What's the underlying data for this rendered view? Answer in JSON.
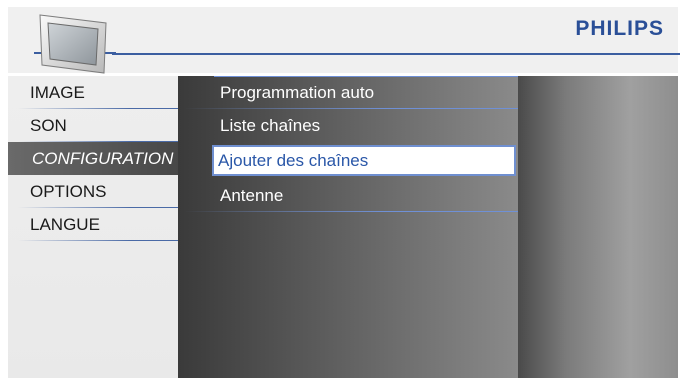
{
  "brand": {
    "name": "PHILIPS",
    "color": "#2a4f97"
  },
  "header": {
    "icon": "tv-monitor-icon"
  },
  "menu": {
    "main_items": [
      {
        "label": "IMAGE",
        "selected": false
      },
      {
        "label": "SON",
        "selected": false
      },
      {
        "label": "CONFIGURATION",
        "selected": true
      },
      {
        "label": "OPTIONS",
        "selected": false
      },
      {
        "label": "LANGUE",
        "selected": false
      }
    ],
    "sub_items": [
      {
        "label": "Programmation auto",
        "focused": false
      },
      {
        "label": "Liste chaînes",
        "focused": false
      },
      {
        "label": "Ajouter des chaînes",
        "focused": true
      },
      {
        "label": "Antenne",
        "focused": false
      }
    ]
  },
  "colors": {
    "accent": "#3b5ea0",
    "focus_text": "#2a57a8",
    "focus_border": "#6f8fd0"
  }
}
